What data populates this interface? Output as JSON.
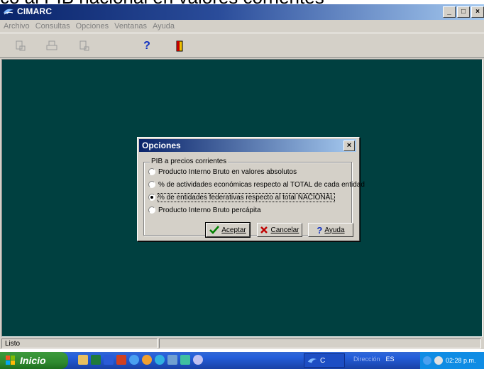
{
  "caption": "co al PIB nacional en valores corrientes",
  "window": {
    "title": "CIMARC",
    "buttons": [
      "_",
      "□",
      "×"
    ]
  },
  "menu": [
    "Archivo",
    "Consultas",
    "Opciones",
    "Ventanas",
    "Ayuda"
  ],
  "toolbar": {
    "help_glyph": "?",
    "icons": [
      "print-preview-icon",
      "print-icon",
      "print-setup-icon",
      "help-icon",
      "exit-door-icon"
    ]
  },
  "dialog": {
    "title": "Opciones",
    "close_glyph": "×",
    "group_label": "PIB a precios corrientes",
    "options": [
      {
        "label": "Producto Interno Bruto en valores absolutos",
        "checked": false
      },
      {
        "label": "% de actividades económicas respecto al TOTAL de cada entidad",
        "checked": false
      },
      {
        "label": "% de entidades federativas respecto al total NACIONAL",
        "checked": true
      },
      {
        "label": "Producto Interno Bruto percápita",
        "checked": false
      }
    ],
    "buttons": {
      "accept": "Aceptar",
      "cancel": "Cancelar",
      "help": "Ayuda"
    }
  },
  "status": {
    "text": "Listo"
  },
  "taskbar": {
    "start_label": "Inicio",
    "task_label": "C",
    "address_label": "Dirección",
    "lang": "ES",
    "clock": "02:28 p.m."
  },
  "colors": {
    "workspace": "#004040",
    "title_start": "#0a246a",
    "title_end": "#a6caf0"
  }
}
